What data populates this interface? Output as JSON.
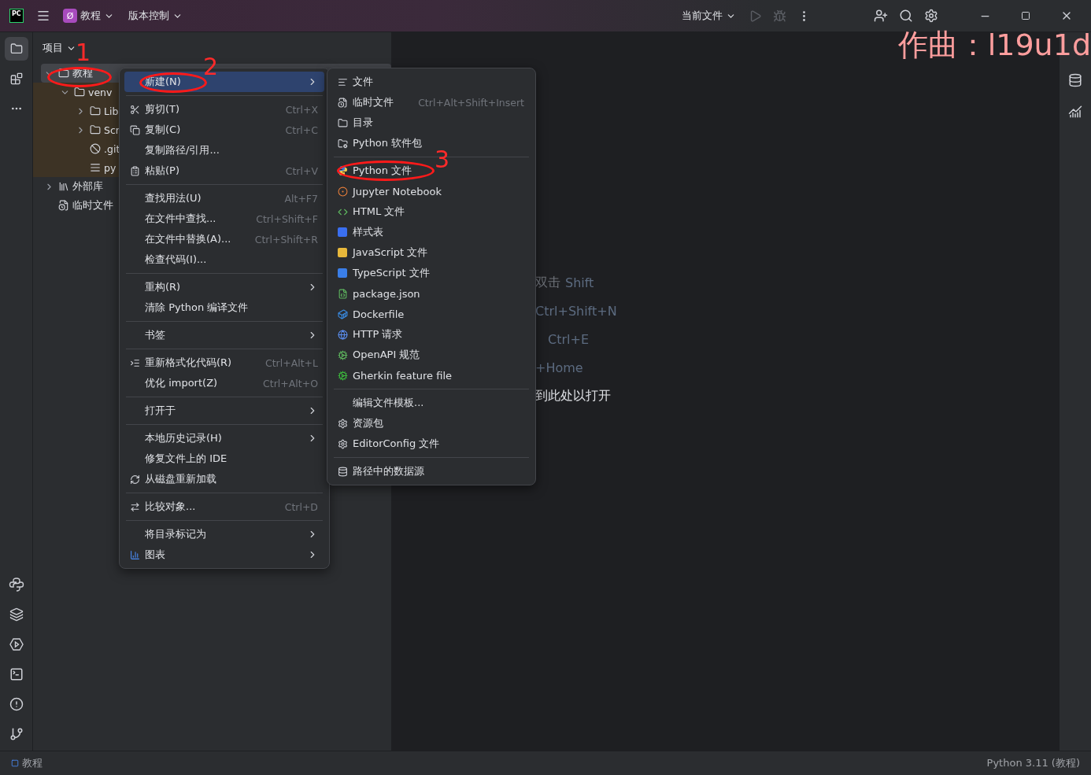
{
  "title_bar": {
    "logo_text": "PC",
    "project": {
      "badge": "Ø",
      "name": "教程"
    },
    "vcs": "版本控制",
    "run_config": "当前文件",
    "run_disabled": true,
    "debug_disabled": true
  },
  "left_toolbar": {
    "project_view_open": true
  },
  "project_panel": {
    "title": "项目",
    "tree": [
      {
        "label": "教程",
        "selected": true,
        "expanded": true,
        "excluded": false,
        "children": [
          {
            "label": "venv",
            "selected": false,
            "expanded": true,
            "excluded": true,
            "children": [
              {
                "label": "Lib",
                "selected": false,
                "expanded": false,
                "excluded": true,
                "kind": "folder"
              },
              {
                "label": "Scr",
                "selected": false,
                "expanded": false,
                "excluded": true,
                "kind": "folder"
              },
              {
                "label": ".git",
                "selected": false,
                "excluded": true,
                "kind": "ignored"
              },
              {
                "label": "py",
                "selected": false,
                "excluded": true,
                "kind": "config"
              }
            ],
            "kind": "folder"
          }
        ],
        "kind": "folder"
      },
      {
        "label": "外部库",
        "selected": false,
        "expanded": false,
        "excluded": false,
        "kind": "library"
      },
      {
        "label": "临时文件",
        "selected": false,
        "excluded": false,
        "kind": "scratch"
      }
    ]
  },
  "context_menu": [
    {
      "kind": "item",
      "label": "新建(N)",
      "submenu": true,
      "selected": true
    },
    {
      "kind": "separator"
    },
    {
      "kind": "item",
      "label": "剪切(T)",
      "shortcut": "Ctrl+X",
      "selected": false
    },
    {
      "kind": "item",
      "label": "复制(C)",
      "shortcut": "Ctrl+C",
      "selected": false
    },
    {
      "kind": "item",
      "label": "复制路径/引用...",
      "selected": false
    },
    {
      "kind": "item",
      "label": "粘贴(P)",
      "shortcut": "Ctrl+V",
      "selected": false
    },
    {
      "kind": "separator"
    },
    {
      "kind": "item",
      "label": "查找用法(U)",
      "shortcut": "Alt+F7",
      "selected": false
    },
    {
      "kind": "item",
      "label": "在文件中查找...",
      "shortcut": "Ctrl+Shift+F",
      "selected": false
    },
    {
      "kind": "item",
      "label": "在文件中替换(A)...",
      "shortcut": "Ctrl+Shift+R",
      "selected": false
    },
    {
      "kind": "item",
      "label": "检查代码(I)...",
      "selected": false
    },
    {
      "kind": "separator"
    },
    {
      "kind": "item",
      "label": "重构(R)",
      "submenu": true,
      "selected": false
    },
    {
      "kind": "item",
      "label": "清除 Python 编译文件",
      "selected": false
    },
    {
      "kind": "separator"
    },
    {
      "kind": "item",
      "label": "书签",
      "submenu": true,
      "selected": false
    },
    {
      "kind": "separator"
    },
    {
      "kind": "item",
      "label": "重新格式化代码(R)",
      "shortcut": "Ctrl+Alt+L",
      "selected": false
    },
    {
      "kind": "item",
      "label": "优化 import(Z)",
      "shortcut": "Ctrl+Alt+O",
      "selected": false
    },
    {
      "kind": "separator"
    },
    {
      "kind": "item",
      "label": "打开于",
      "submenu": true,
      "selected": false
    },
    {
      "kind": "separator"
    },
    {
      "kind": "item",
      "label": "本地历史记录(H)",
      "submenu": true,
      "selected": false
    },
    {
      "kind": "item",
      "label": "修复文件上的 IDE",
      "selected": false
    },
    {
      "kind": "item",
      "label": "从磁盘重新加载",
      "selected": false
    },
    {
      "kind": "separator"
    },
    {
      "kind": "item",
      "label": "比较对象...",
      "shortcut": "Ctrl+D",
      "selected": false
    },
    {
      "kind": "separator"
    },
    {
      "kind": "item",
      "label": "将目录标记为",
      "submenu": true,
      "selected": false
    },
    {
      "kind": "item",
      "label": "图表",
      "submenu": true,
      "selected": false
    }
  ],
  "new_submenu": [
    {
      "kind": "item",
      "label": "文件",
      "selected": false
    },
    {
      "kind": "item",
      "label": "临时文件",
      "shortcut": "Ctrl+Alt+Shift+Insert",
      "selected": false
    },
    {
      "kind": "item",
      "label": "目录",
      "selected": false
    },
    {
      "kind": "item",
      "label": "Python 软件包",
      "selected": false
    },
    {
      "kind": "separator"
    },
    {
      "kind": "item",
      "label": "Python 文件",
      "selected": false
    },
    {
      "kind": "item",
      "label": "Jupyter Notebook",
      "selected": false
    },
    {
      "kind": "item",
      "label": "HTML 文件",
      "selected": false
    },
    {
      "kind": "item",
      "label": "样式表",
      "selected": false
    },
    {
      "kind": "item",
      "label": "JavaScript 文件",
      "selected": false
    },
    {
      "kind": "item",
      "label": "TypeScript 文件",
      "selected": false
    },
    {
      "kind": "item",
      "label": "package.json",
      "selected": false
    },
    {
      "kind": "item",
      "label": "Dockerfile",
      "selected": false
    },
    {
      "kind": "item",
      "label": "HTTP 请求",
      "selected": false
    },
    {
      "kind": "item",
      "label": "OpenAPI 规范",
      "selected": false
    },
    {
      "kind": "item",
      "label": "Gherkin feature file",
      "selected": false
    },
    {
      "kind": "separator"
    },
    {
      "kind": "item",
      "label": "编辑文件模板...",
      "selected": false
    },
    {
      "kind": "item",
      "label": "资源包",
      "selected": false
    },
    {
      "kind": "item",
      "label": "EditorConfig 文件",
      "selected": false
    },
    {
      "kind": "separator"
    },
    {
      "kind": "item",
      "label": "路径中的数据源",
      "selected": false
    }
  ],
  "editor_hints": [
    {
      "label": "双击",
      "shortcut": "Shift"
    },
    {
      "shortcut": "Ctrl+Shift+N"
    },
    {
      "shortcut": "Ctrl+E"
    },
    {
      "shortcut": "+Home"
    },
    {
      "label": "到此处以打开"
    }
  ],
  "overlay_text": "作曲：l19u1d",
  "annotations": [
    {
      "label": "1"
    },
    {
      "label": "2"
    },
    {
      "label": "3"
    }
  ],
  "status_bar": {
    "project": "教程",
    "interpreter": "Python 3.11 (教程)"
  }
}
